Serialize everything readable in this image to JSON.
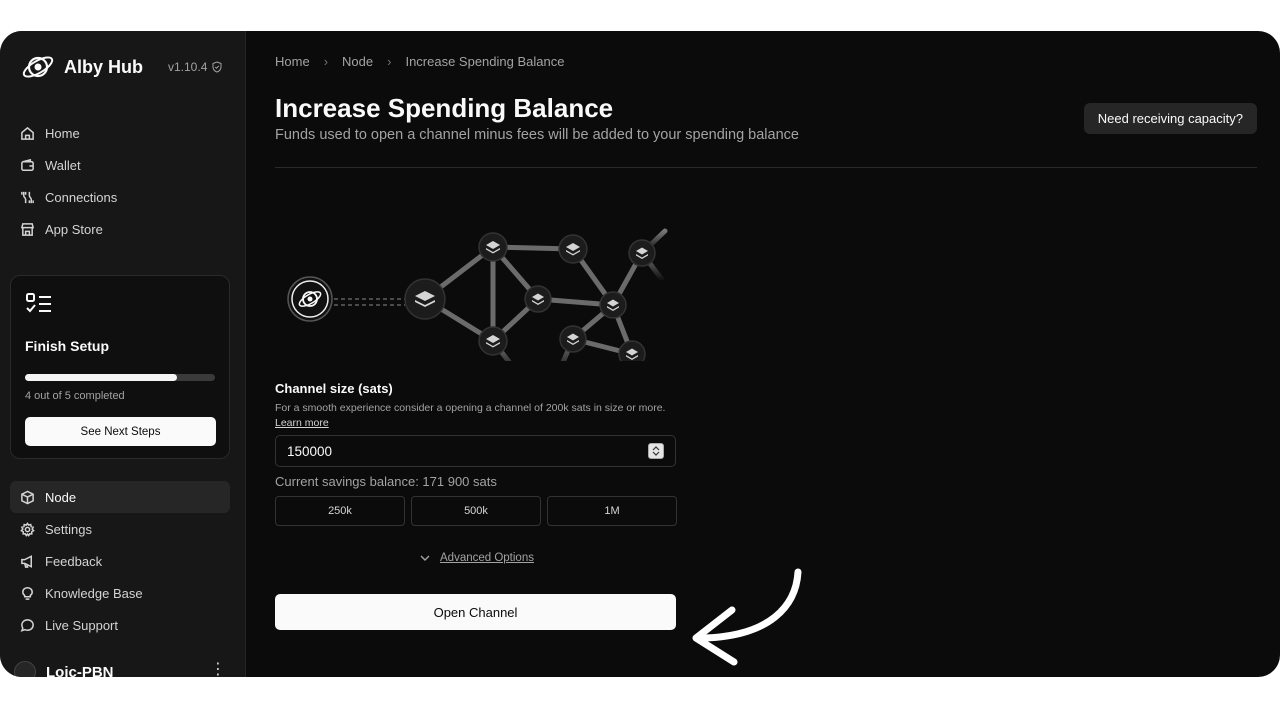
{
  "sidebar": {
    "logo_text": "Alby Hub",
    "version": "v1.10.4",
    "nav_top": [
      {
        "label": "Home",
        "icon": "home-icon"
      },
      {
        "label": "Wallet",
        "icon": "wallet-icon"
      },
      {
        "label": "Connections",
        "icon": "connections-icon"
      },
      {
        "label": "App Store",
        "icon": "store-icon"
      }
    ],
    "setup": {
      "title": "Finish Setup",
      "progress_completed": 4,
      "progress_total": 5,
      "progress_text": "4 out of 5 completed",
      "button": "See Next Steps"
    },
    "nav_bottom": [
      {
        "label": "Node",
        "icon": "node-icon",
        "active": true
      },
      {
        "label": "Settings",
        "icon": "gear-icon"
      },
      {
        "label": "Feedback",
        "icon": "megaphone-icon"
      },
      {
        "label": "Knowledge Base",
        "icon": "lightbulb-icon"
      },
      {
        "label": "Live Support",
        "icon": "chat-icon"
      }
    ],
    "user_name": "Loic-PBN"
  },
  "breadcrumb": [
    "Home",
    "Node",
    "Increase Spending Balance"
  ],
  "header": {
    "title": "Increase Spending Balance",
    "subtitle": "Funds used to open a channel minus fees will be added to your spending balance",
    "capacity_button": "Need receiving capacity?"
  },
  "form": {
    "label": "Channel size (sats)",
    "hint": "For a smooth experience consider a opening a channel of 200k sats in size or more.",
    "hint_link": "Learn more",
    "value": "150000",
    "savings_balance": "Current savings balance: 171 900 sats",
    "presets": [
      "250k",
      "500k",
      "1M"
    ],
    "advanced": "Advanced Options",
    "submit": "Open Channel"
  },
  "colors": {
    "background": "#0b0b0b",
    "sidebar": "#171717",
    "primary_button": "#fafafa"
  }
}
